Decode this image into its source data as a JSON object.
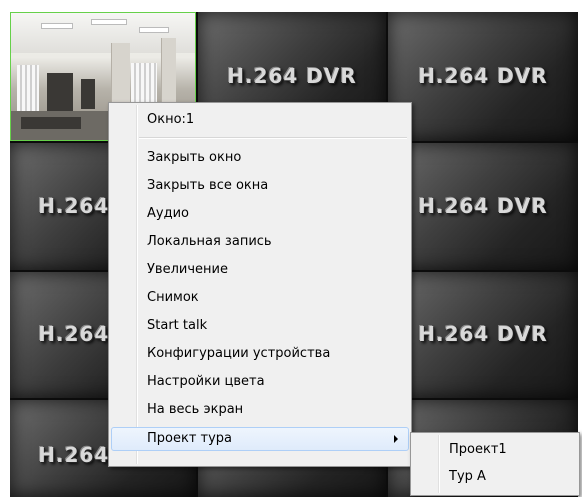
{
  "grid": {
    "cell_label": "H.264 DVR",
    "selected_window": 1
  },
  "context_menu": {
    "header": "Окно:1",
    "items": [
      "Закрыть окно",
      "Закрыть все окна",
      "Аудио",
      "Локальная запись",
      "Увеличение",
      "Снимок",
      "Start talk",
      "Конфигурации устройства",
      "Настройки цвета",
      "На весь экран",
      "Проект тура"
    ],
    "highlighted_item": "Проект тура"
  },
  "submenu": {
    "items": [
      "Проект1",
      "Тур А"
    ]
  },
  "colors": {
    "selection_border": "#66d04a",
    "menu_bg": "#f0f0f0",
    "highlight_border": "#aecff7"
  },
  "icons": {
    "submenu": "chevron-right-icon"
  }
}
